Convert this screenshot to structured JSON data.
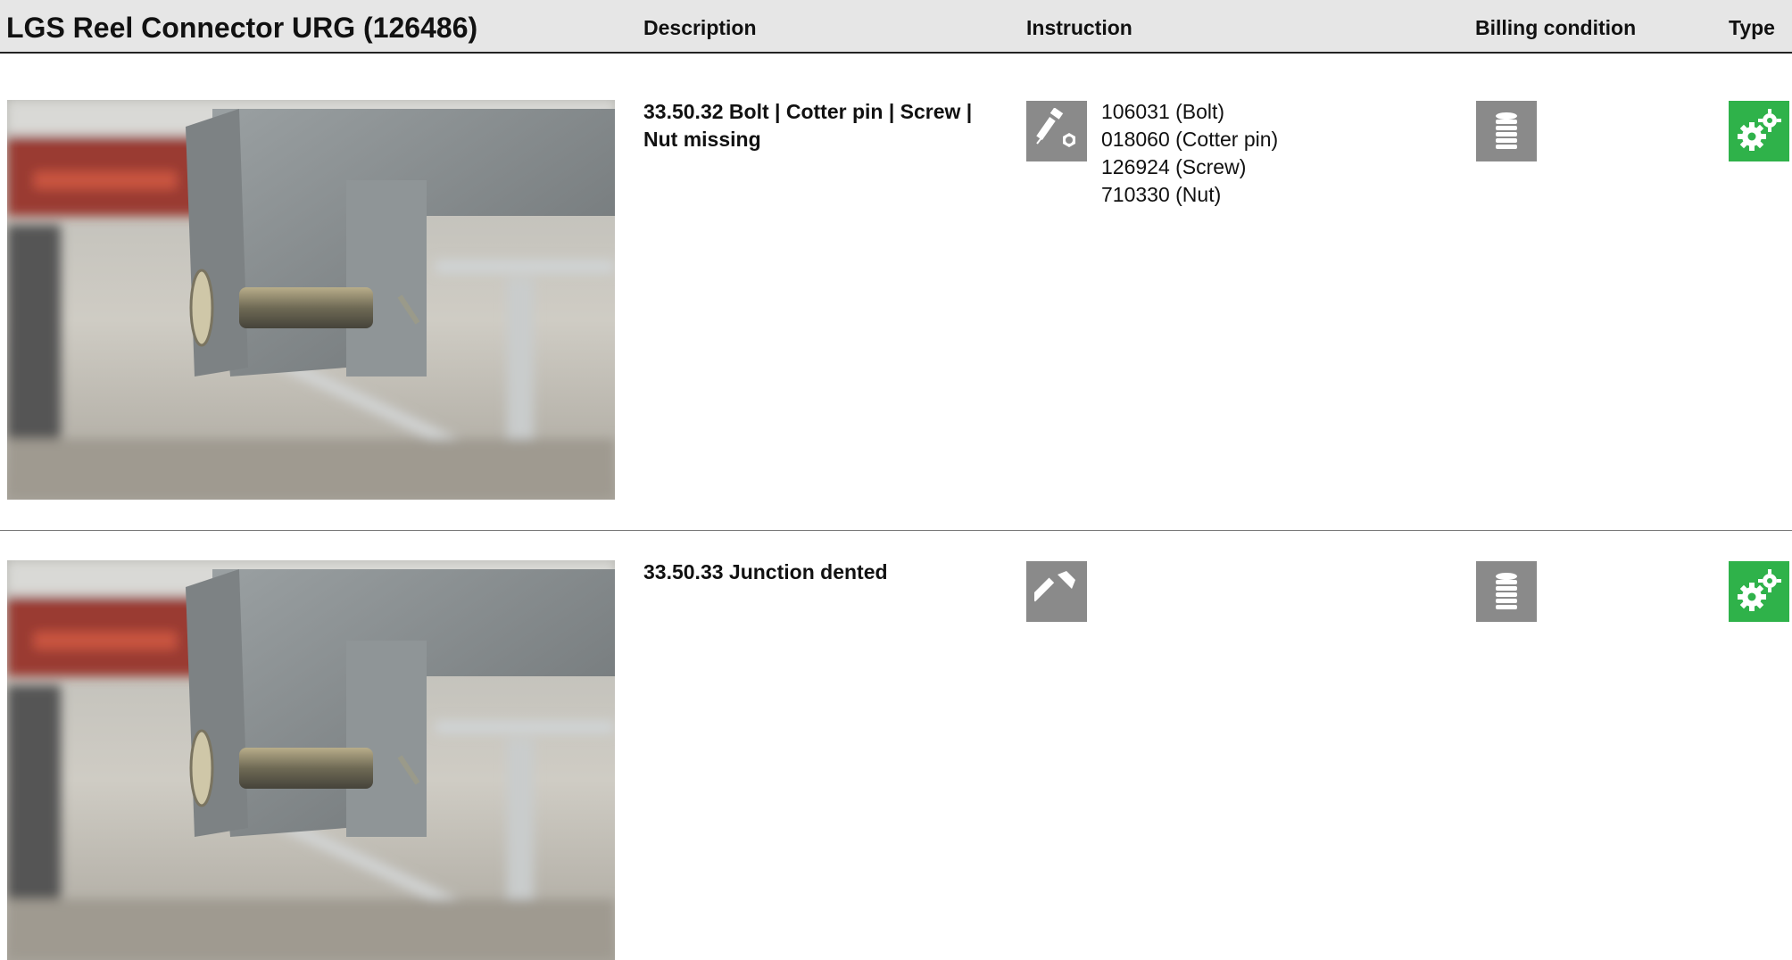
{
  "header": {
    "title": "LGS Reel Connector URG (126486)",
    "col_description": "Description",
    "col_instruction": "Instruction",
    "col_billing": "Billing condition",
    "col_type": "Type"
  },
  "rows": [
    {
      "description": "33.50.32 Bolt | Cotter pin | Screw | Nut missing",
      "instruction_icon": "bolt-nut-icon",
      "parts": [
        "106031 (Bolt)",
        "018060 (Cotter pin)",
        "126924 (Screw)",
        "710330 (Nut)"
      ],
      "billing_icon": "coin-stack-icon",
      "type_icon": "gears-icon"
    },
    {
      "description": "33.50.33 Junction dented",
      "instruction_icon": "hammer-icon",
      "billing_icon": "coin-stack-icon",
      "type_icon": "gears-icon"
    }
  ],
  "colors": {
    "header_bg": "#e6e6e6",
    "icon_grey": "#8a8a8a",
    "icon_green": "#2fb24a"
  }
}
